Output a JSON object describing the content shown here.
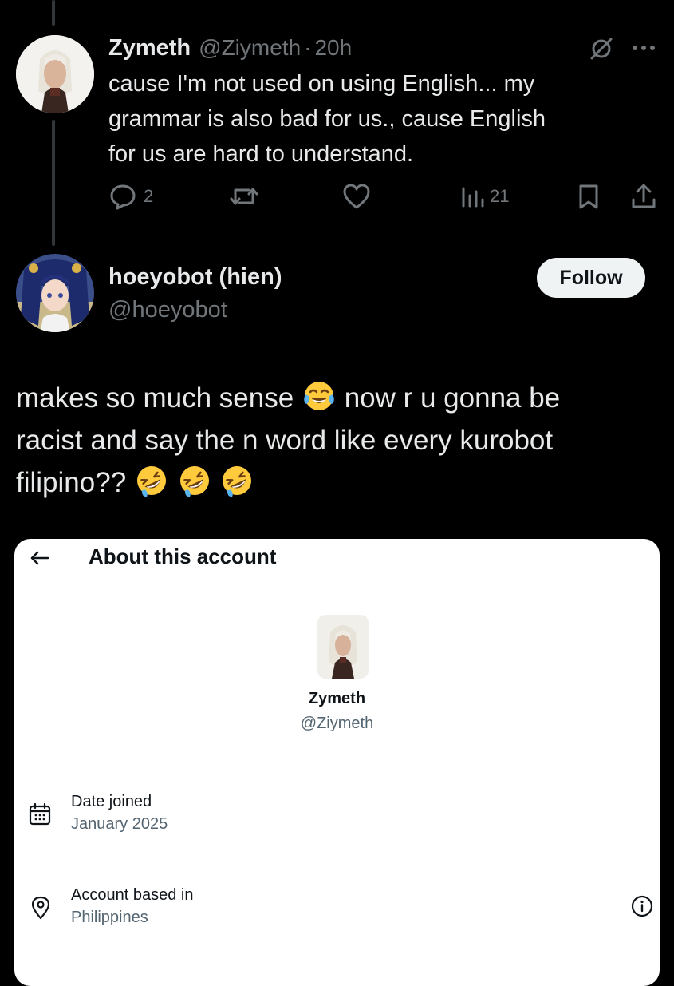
{
  "tweet": {
    "display_name": "Zymeth",
    "handle": "@Ziymeth",
    "separator": "·",
    "time": "20h",
    "text_lines": [
      "cause I'm not used on using English... my",
      "grammar is also bad for us., cause English",
      "for us are hard to understand."
    ],
    "replies": "2",
    "views": "21"
  },
  "reply": {
    "display_name": "hoeyobot (hien)",
    "handle": "@hoeyobot",
    "follow_label": "Follow",
    "line1_a": "makes so much sense",
    "line1_b": "now r u gonna be",
    "line2": "racist and say the n word like every kurobot",
    "line3": "filipino??"
  },
  "about": {
    "title": "About this account",
    "display_name": "Zymeth",
    "handle": "@Ziymeth",
    "date_joined_label": "Date joined",
    "date_joined_value": "January 2025",
    "based_in_label": "Account based in",
    "based_in_value": "Philippines"
  },
  "icons": {
    "grok": "slashed-circle-icon",
    "more": "more-dots-icon",
    "reply": "reply-bubble-icon",
    "repost": "repost-icon",
    "like": "heart-icon",
    "views": "views-bars-icon",
    "bookmark": "bookmark-icon",
    "share": "share-icon",
    "back": "back-arrow-icon",
    "calendar": "calendar-icon",
    "location": "location-pin-icon",
    "info": "info-icon",
    "emoji_joy": "tears-of-joy-emoji",
    "emoji_rofl": "rolling-laughing-emoji"
  },
  "colors": {
    "background": "#000000",
    "text": "#e7e9ea",
    "muted": "#71767b",
    "sheet": "#ffffff"
  }
}
